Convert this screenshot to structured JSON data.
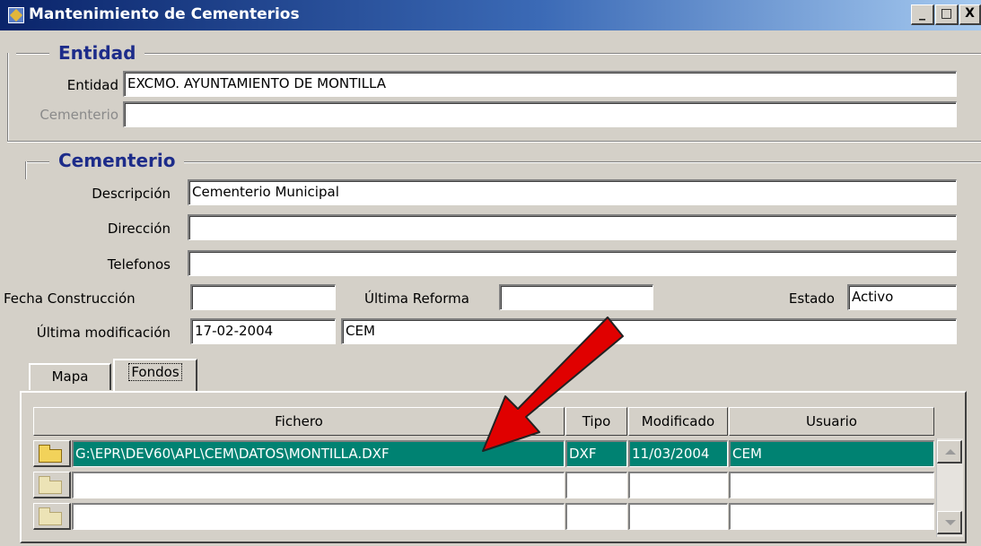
{
  "window": {
    "title": "Mantenimiento de Cementerios",
    "controls": {
      "minimize": "_",
      "maximize": "□",
      "close": "X"
    }
  },
  "entidad_section": {
    "title": "Entidad",
    "entidad_label": "Entidad",
    "entidad_value": "EXCMO. AYUNTAMIENTO DE MONTILLA",
    "cementerio_label": "Cementerio",
    "cementerio_value": ""
  },
  "cementerio_section": {
    "title": "Cementerio",
    "descripcion_label": "Descripción",
    "descripcion_value": "Cementerio Municipal",
    "direccion_label": "Dirección",
    "direccion_value": "",
    "telefonos_label": "Telefonos",
    "telefonos_value": "",
    "fecha_construccion_label": "Fecha Construcción",
    "fecha_construccion_value": "",
    "ultima_reforma_label": "Última Reforma",
    "ultima_reforma_value": "",
    "estado_label": "Estado",
    "estado_value": "Activo",
    "ultima_modificacion_label": "Última modificación",
    "ultima_modificacion_fecha": "17-02-2004",
    "ultima_modificacion_usuario": "CEM"
  },
  "tabs": [
    {
      "label": "Mapa",
      "active": false
    },
    {
      "label": "Fondos",
      "active": true
    }
  ],
  "grid": {
    "columns": [
      "Fichero",
      "Tipo",
      "Modificado",
      "Usuario"
    ],
    "rows": [
      {
        "fichero": "G:\\EPR\\DEV60\\APL\\CEM\\DATOS\\MONTILLA.DXF",
        "tipo": "DXF",
        "modificado": "11/03/2004",
        "usuario": "CEM",
        "selected": true
      },
      {
        "fichero": "",
        "tipo": "",
        "modificado": "",
        "usuario": "",
        "selected": false
      },
      {
        "fichero": "",
        "tipo": "",
        "modificado": "",
        "usuario": "",
        "selected": false
      }
    ]
  },
  "icons": {
    "row_button": "open-folder-icon",
    "annotation": "red-arrow-icon"
  },
  "colors": {
    "title_bar": "#0a246a",
    "section_title": "#1d2c8a",
    "selected_row": "#008272",
    "annotation_arrow": "#e00000"
  }
}
